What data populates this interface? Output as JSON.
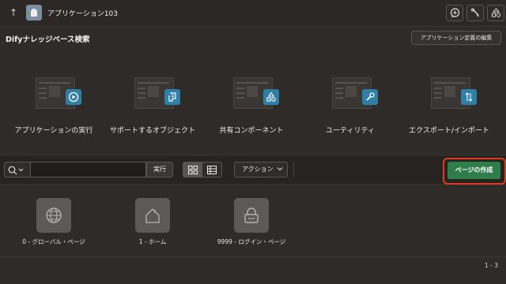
{
  "topbar": {
    "app_title": "アプリケーション103",
    "icons": [
      "arrow-up-icon",
      "ghost-app-icon",
      "chat-icon",
      "brush-icon",
      "shapes-icon"
    ]
  },
  "header": {
    "page_title": "Difyナレッジベース検索",
    "edit_button_label": "アプリケーション定義の編集"
  },
  "tiles": [
    {
      "label": "アプリケーションの実行",
      "icon": "play-icon"
    },
    {
      "label": "サポートするオブジェクト",
      "icon": "document-icon"
    },
    {
      "label": "共有コンポーネント",
      "icon": "shapes-icon"
    },
    {
      "label": "ユーティリティ",
      "icon": "wrench-icon"
    },
    {
      "label": "エクスポート/インポート",
      "icon": "up-down-arrows-icon"
    }
  ],
  "toolbar": {
    "search_value": "",
    "go_label": "実行",
    "view_selected": "icons",
    "actions_label": "アクション",
    "create_page_label": "ページの作成"
  },
  "pages": [
    {
      "label": "0 - グローバル・ページ",
      "icon": "globe-icon"
    },
    {
      "label": "1 - ホーム",
      "icon": "home-icon"
    },
    {
      "label": "9999 - ログイン・ページ",
      "icon": "lock-icon"
    }
  ],
  "pagination": "1 - 3",
  "colors": {
    "background": "#2e2b29",
    "create_button": "#2e7d4b",
    "highlight": "#e23a22",
    "tile_badge": "#2f7fa6"
  }
}
